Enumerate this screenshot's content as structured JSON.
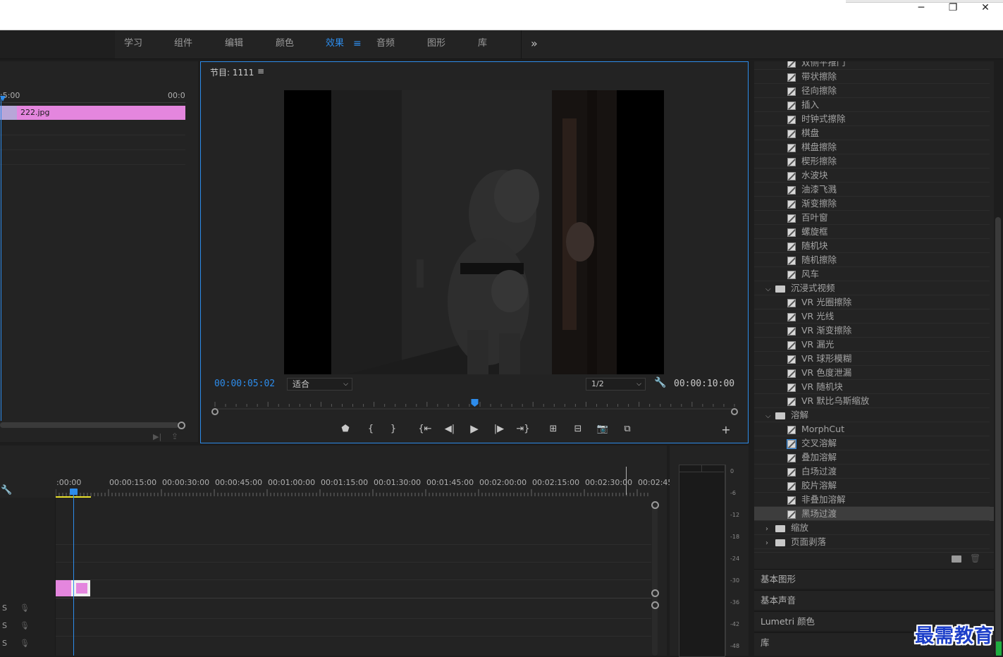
{
  "window": {
    "minimize": "─",
    "restore": "❐",
    "close": "✕"
  },
  "workspaces": [
    {
      "label": "学习"
    },
    {
      "label": "组件"
    },
    {
      "label": "编辑"
    },
    {
      "label": "颜色"
    },
    {
      "label": "效果",
      "active": true
    },
    {
      "label": "音频"
    },
    {
      "label": "图形"
    },
    {
      "label": "库"
    }
  ],
  "workspace_menu_icon": "≡",
  "workspace_overflow": "»",
  "source_panel": {
    "tc_left": ":5:00",
    "tc_right": "00:0",
    "clip_label": "222.jpg"
  },
  "program": {
    "title": "节目: 1111",
    "menu_icon": "≡",
    "timecode": "00:00:05:02",
    "fit_label": "适合",
    "resolution": "1/2",
    "duration": "00:00:10:00",
    "playhead_fraction": 0.5
  },
  "timeline": {
    "ticks": [
      ":00:00",
      "00:00:15:00",
      "00:00:30:00",
      "00:00:45:00",
      "00:01:00:00",
      "00:01:15:00",
      "00:01:30:00",
      "00:01:45:00",
      "00:02:00:00",
      "00:02:15:00",
      "00:02:30:00",
      "00:02:45:"
    ],
    "track_labels": [
      {
        "label": "S"
      },
      {
        "label": "S"
      },
      {
        "label": "S"
      }
    ]
  },
  "meter": {
    "labels": [
      "0",
      "-6",
      "-12",
      "-18",
      "-24",
      "-30",
      "-36",
      "-42",
      "-48"
    ]
  },
  "effects": {
    "items": [
      {
        "type": "effect",
        "label": "双侧平推门",
        "indent": 1
      },
      {
        "type": "effect",
        "label": "带状擦除",
        "indent": 1
      },
      {
        "type": "effect",
        "label": "径向擦除",
        "indent": 1
      },
      {
        "type": "effect",
        "label": "插入",
        "indent": 1
      },
      {
        "type": "effect",
        "label": "时钟式擦除",
        "indent": 1
      },
      {
        "type": "effect",
        "label": "棋盘",
        "indent": 1
      },
      {
        "type": "effect",
        "label": "棋盘擦除",
        "indent": 1
      },
      {
        "type": "effect",
        "label": "楔形擦除",
        "indent": 1
      },
      {
        "type": "effect",
        "label": "水波块",
        "indent": 1
      },
      {
        "type": "effect",
        "label": "油漆飞溅",
        "indent": 1
      },
      {
        "type": "effect",
        "label": "渐变擦除",
        "indent": 1
      },
      {
        "type": "effect",
        "label": "百叶窗",
        "indent": 1
      },
      {
        "type": "effect",
        "label": "螺旋框",
        "indent": 1
      },
      {
        "type": "effect",
        "label": "随机块",
        "indent": 1
      },
      {
        "type": "effect",
        "label": "随机擦除",
        "indent": 1
      },
      {
        "type": "effect",
        "label": "风车",
        "indent": 1
      },
      {
        "type": "folder",
        "label": "沉浸式视频",
        "expanded": true
      },
      {
        "type": "effect",
        "label": "VR 光圈擦除",
        "indent": 1
      },
      {
        "type": "effect",
        "label": "VR 光线",
        "indent": 1
      },
      {
        "type": "effect",
        "label": "VR 渐变擦除",
        "indent": 1
      },
      {
        "type": "effect",
        "label": "VR 漏光",
        "indent": 1
      },
      {
        "type": "effect",
        "label": "VR 球形模糊",
        "indent": 1
      },
      {
        "type": "effect",
        "label": "VR 色度泄漏",
        "indent": 1
      },
      {
        "type": "effect",
        "label": "VR 随机块",
        "indent": 1
      },
      {
        "type": "effect",
        "label": "VR 默比乌斯缩放",
        "indent": 1
      },
      {
        "type": "folder",
        "label": "溶解",
        "expanded": true
      },
      {
        "type": "effect",
        "label": "MorphCut",
        "indent": 1
      },
      {
        "type": "effect",
        "label": "交叉溶解",
        "indent": 1,
        "outlined": true
      },
      {
        "type": "effect",
        "label": "叠加溶解",
        "indent": 1
      },
      {
        "type": "effect",
        "label": "白场过渡",
        "indent": 1
      },
      {
        "type": "effect",
        "label": "胶片溶解",
        "indent": 1
      },
      {
        "type": "effect",
        "label": "非叠加溶解",
        "indent": 1
      },
      {
        "type": "effect",
        "label": "黑场过渡",
        "indent": 1,
        "selected": true
      },
      {
        "type": "folder",
        "label": "缩放",
        "expanded": false
      },
      {
        "type": "folder",
        "label": "页面剥落",
        "expanded": false
      }
    ]
  },
  "side_panels": [
    {
      "label": "基本图形"
    },
    {
      "label": "基本声音"
    },
    {
      "label": "Lumetri 颜色"
    },
    {
      "label": "库"
    }
  ],
  "watermark": "最需教育",
  "colors": {
    "accent": "#2d8ceb",
    "clip_pink": "#e486de",
    "selected_row": "#3d3d3d",
    "work_area": "#e8e02a"
  }
}
